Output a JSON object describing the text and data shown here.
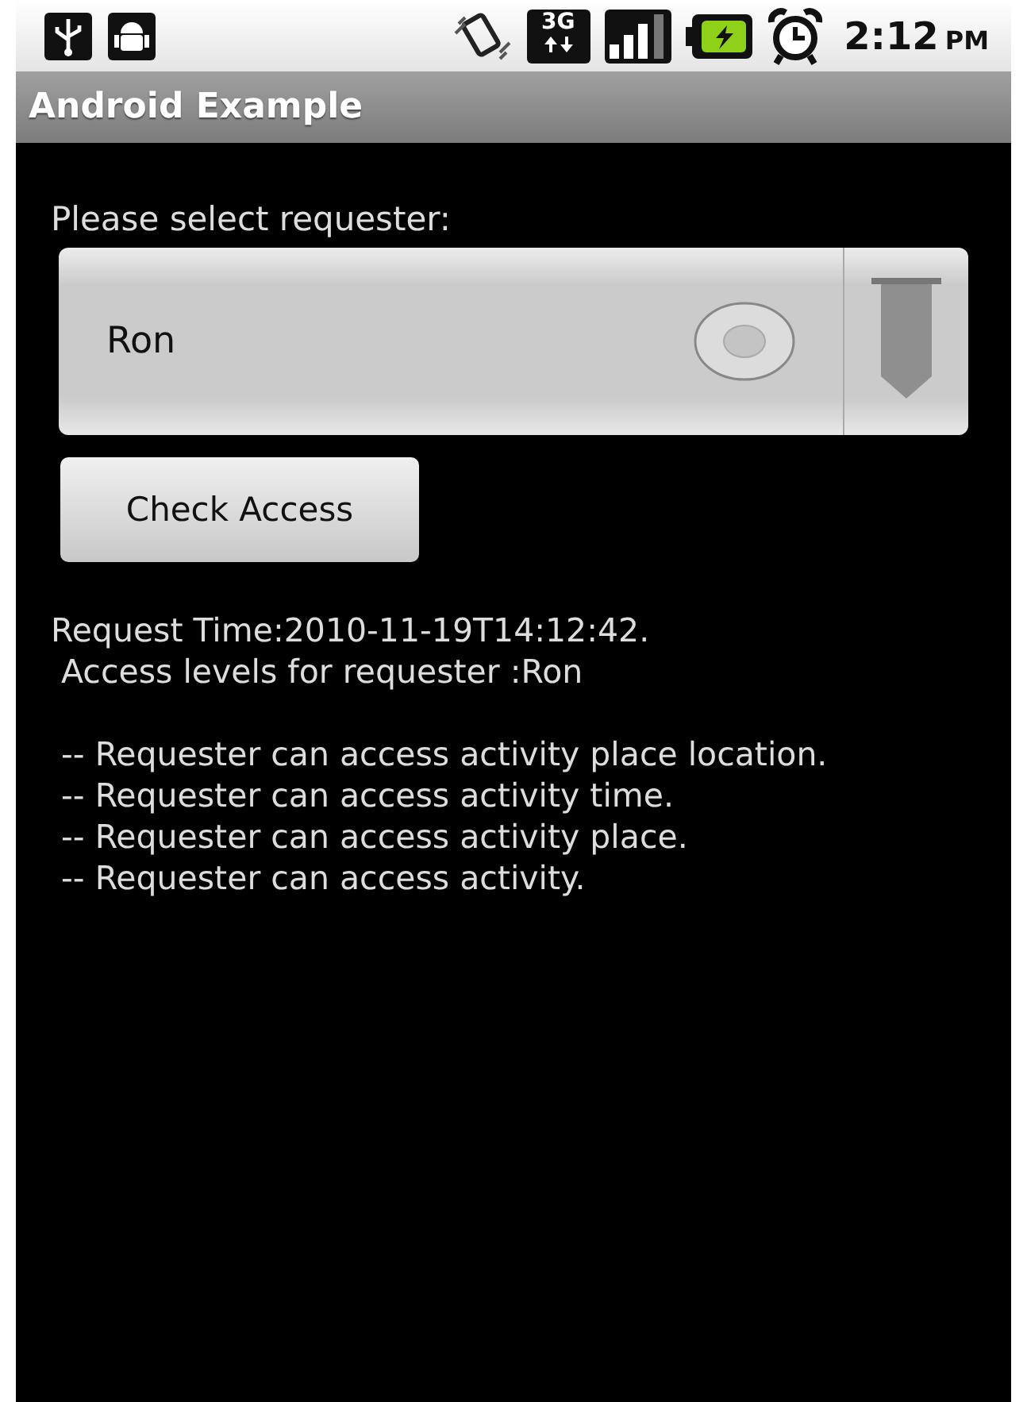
{
  "status_bar": {
    "network": "3G",
    "time": "2:12",
    "meridiem": "PM"
  },
  "title_bar": {
    "title": "Android Example"
  },
  "prompt": "Please select requester:",
  "spinner": {
    "value": "Ron"
  },
  "button": {
    "label": "Check Access"
  },
  "result": {
    "lines": [
      "Request Time:2010-11-19T14:12:42.",
      " Access levels for requester :Ron"
    ],
    "access_lines": [
      " -- Requester can access activity place location.",
      " -- Requester can access activity time.",
      " -- Requester can access activity place.",
      " -- Requester can access activity."
    ]
  }
}
